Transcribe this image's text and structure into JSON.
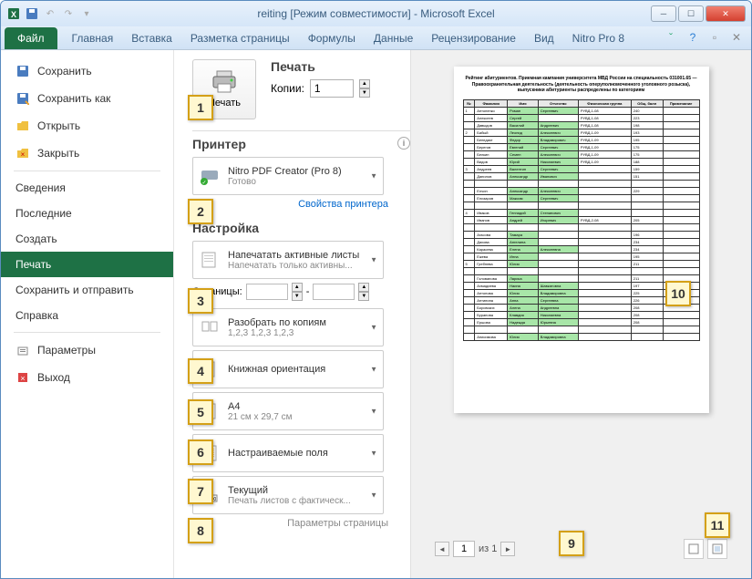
{
  "window": {
    "title": "reiting  [Режим совместимости]  -  Microsoft Excel"
  },
  "ribbon": {
    "file": "Файл",
    "tabs": [
      "Главная",
      "Вставка",
      "Разметка страницы",
      "Формулы",
      "Данные",
      "Рецензирование",
      "Вид",
      "Nitro Pro 8"
    ]
  },
  "backstage_nav": {
    "save": "Сохранить",
    "save_as": "Сохранить как",
    "open": "Открыть",
    "close": "Закрыть",
    "info": "Сведения",
    "recent": "Последние",
    "new": "Создать",
    "print": "Печать",
    "share": "Сохранить и отправить",
    "help": "Справка",
    "options": "Параметры",
    "exit": "Выход"
  },
  "print": {
    "header": "Печать",
    "button": "Печать",
    "copies_label": "Копии:",
    "copies_value": "1",
    "printer_section": "Принтер",
    "printer_name": "Nitro PDF Creator (Pro 8)",
    "printer_status": "Готово",
    "printer_props": "Свойства принтера",
    "settings_section": "Настройка",
    "settings": {
      "what_main": "Напечатать активные листы",
      "what_sub": "Напечатать только активны...",
      "pages_label": "Страницы:",
      "pages_to": "-",
      "collate_main": "Разобрать по копиям",
      "collate_sub": "1,2,3   1,2,3   1,2,3",
      "orient_main": "Книжная ориентация",
      "orient_sub": "",
      "size_main": "A4",
      "size_sub": "21 см x 29,7 см",
      "margins_main": "Настраиваемые поля",
      "margins_sub": "",
      "scaling_main": "Текущий",
      "scaling_sub": "Печать листов с фактическ...",
      "page_setup": "Параметры страницы"
    }
  },
  "preview": {
    "page_current": "1",
    "page_of": "из 1",
    "doc_title": "Рейтинг абитуриентов. Приемная кампания университета МВД России на специальность 031001.65 — Правоохранительная деятельность (деятельность оперуполномоченного уголовного розыска), выпускники абитуриенты распределены по категориям",
    "headers": [
      "№",
      "Фамилия",
      "Имя",
      "Отчество",
      "Физическая группа",
      "Общ. балл",
      "Примечание"
    ],
    "rows": [
      [
        "1",
        "Антоненко",
        "Роман",
        "Сергеевич",
        "РУВД-1-08",
        "240",
        ""
      ],
      [
        "",
        "Алексеев",
        "Сергей",
        "",
        "РУВД-1-08",
        "223",
        ""
      ],
      [
        "",
        "Давыдов",
        "Василий",
        "Андреевич",
        "РУВД-1-08",
        "198",
        ""
      ],
      [
        "2",
        "Бабый",
        "Леонид",
        "Алексеевич",
        "РУВД-1-09",
        "193",
        ""
      ],
      [
        "",
        "Бенедикт",
        "Федор",
        "Владимирович",
        "РУВД-1-09",
        "195",
        ""
      ],
      [
        "",
        "Берегов",
        "Евгений",
        "Сергеевич",
        "РУВД-1-09",
        "175",
        ""
      ],
      [
        "",
        "Белкин",
        "Семен",
        "Алексеевич",
        "РУВД-1-09",
        "175",
        ""
      ],
      [
        "",
        "Видов",
        "Юрий",
        "Николаевич",
        "РУВД-1-09",
        "188",
        ""
      ],
      [
        "3",
        "Андреев",
        "Валентин",
        "Сергеевич",
        "",
        "159",
        ""
      ],
      [
        "",
        "Данилов",
        "Александр",
        "Иванович",
        "",
        "151",
        ""
      ],
      [
        "",
        "",
        "",
        "",
        "",
        "",
        ""
      ],
      [
        "",
        "Елчин",
        "Александр",
        "Алексеевич",
        "",
        "229",
        ""
      ],
      [
        "",
        "Елизаров",
        "Максим",
        "Сергеевич",
        "",
        "",
        ""
      ],
      [
        "",
        "",
        "",
        "",
        "",
        "",
        ""
      ],
      [
        "4",
        "Иваков",
        "Геннадий",
        "Степанович",
        "",
        "",
        ""
      ],
      [
        "",
        "Иванов",
        "Андрей",
        "Игоревич",
        "РУВД-2-08",
        "205",
        ""
      ],
      [
        "",
        "",
        "",
        "",
        "",
        "",
        ""
      ],
      [
        "",
        "Агасова",
        "Тамара",
        "",
        "",
        "196",
        ""
      ],
      [
        "",
        "Дахова",
        "Ангелина",
        "",
        "",
        "234",
        ""
      ],
      [
        "",
        "Карасева",
        "Елена",
        "Алексеевна",
        "",
        "234",
        ""
      ],
      [
        "",
        "Ежева",
        "Инна",
        "",
        "",
        "195",
        ""
      ],
      [
        "5",
        "Гребнева",
        "Юлия",
        "",
        "",
        "211",
        ""
      ],
      [
        "",
        "",
        "",
        "",
        "",
        "",
        ""
      ],
      [
        "",
        "Голованова",
        "Лариса",
        "",
        "",
        "211",
        ""
      ],
      [
        "",
        "Ахмадиева",
        "Наина",
        "Шавкатовна",
        "",
        "197",
        ""
      ],
      [
        "",
        "Антонова",
        "Юлия",
        "Владимировна",
        "",
        "225",
        ""
      ],
      [
        "",
        "Антипина",
        "Анна",
        "Сергеевна",
        "",
        "226",
        ""
      ],
      [
        "",
        "Боровских",
        "Алена",
        "Андреевна",
        "",
        "208",
        ""
      ],
      [
        "",
        "Буранова",
        "Клавдия",
        "Николаевна",
        "",
        "208",
        ""
      ],
      [
        "",
        "Ершова",
        "Надежда",
        "Юрьевна",
        "",
        "208",
        ""
      ],
      [
        "",
        "",
        "",
        "",
        "",
        "",
        ""
      ],
      [
        "",
        "Анисимова",
        "Юлия",
        "Владимировна",
        "",
        "",
        ""
      ]
    ]
  },
  "callouts": [
    "1",
    "2",
    "3",
    "4",
    "5",
    "6",
    "7",
    "8",
    "9",
    "10",
    "11"
  ]
}
